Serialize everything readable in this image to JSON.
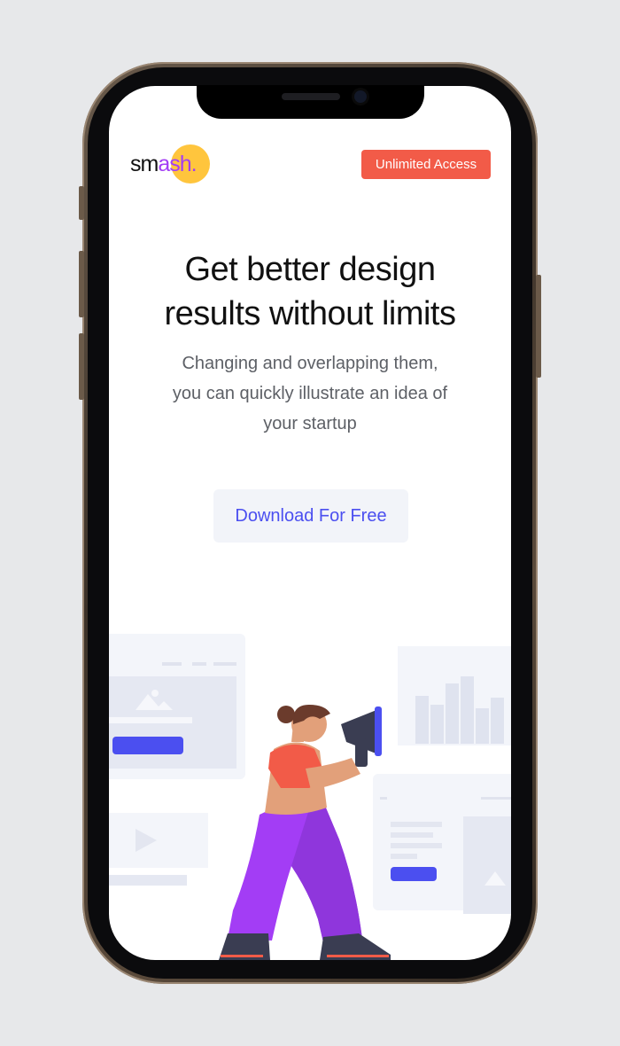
{
  "brand": {
    "logo_prefix": "sm",
    "logo_accent": "ash",
    "logo_suffix": ".",
    "accent_color": "#a33df5",
    "dot_color": "#ffc53d"
  },
  "header": {
    "cta_label": "Unlimited Access",
    "cta_color": "#f25b48"
  },
  "hero": {
    "title_line1": "Get better design",
    "title_line2": "results without limits",
    "subtitle_line1": "Changing and overlapping them,",
    "subtitle_line2": "you can quickly illustrate an idea of",
    "subtitle_line3": "your startup",
    "download_label": "Download For Free",
    "download_color": "#4b4ff0"
  },
  "illustration": {
    "name": "person-with-megaphone-illustration"
  }
}
